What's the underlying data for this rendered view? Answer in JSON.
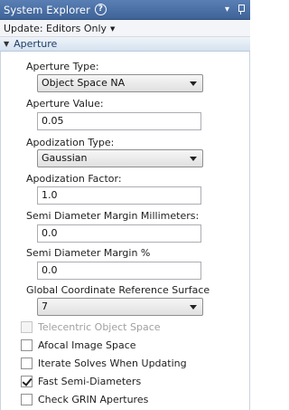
{
  "window": {
    "title": "System Explorer"
  },
  "update": {
    "label": "Update: Editors Only"
  },
  "section": {
    "title": "Aperture"
  },
  "aperture_type": {
    "label": "Aperture Type:",
    "value": "Object Space NA"
  },
  "aperture_value": {
    "label": "Aperture Value:",
    "value": "0.05"
  },
  "apodization_type": {
    "label": "Apodization Type:",
    "value": "Gaussian"
  },
  "apodization_factor": {
    "label": "Apodization Factor:",
    "value": "1.0"
  },
  "semi_dia_mm": {
    "label": "Semi Diameter Margin Millimeters:",
    "value": "0.0"
  },
  "semi_dia_pct": {
    "label": "Semi Diameter Margin %",
    "value": "0.0"
  },
  "global_ref": {
    "label": "Global Coordinate Reference Surface",
    "value": "7"
  },
  "checkboxes": [
    {
      "label": "Telecentric Object Space",
      "checked": false,
      "disabled": true
    },
    {
      "label": "Afocal Image Space",
      "checked": false,
      "disabled": false
    },
    {
      "label": "Iterate Solves When Updating",
      "checked": false,
      "disabled": false
    },
    {
      "label": "Fast Semi-Diameters",
      "checked": true,
      "disabled": false
    },
    {
      "label": "Check GRIN Apertures",
      "checked": false,
      "disabled": false
    }
  ]
}
